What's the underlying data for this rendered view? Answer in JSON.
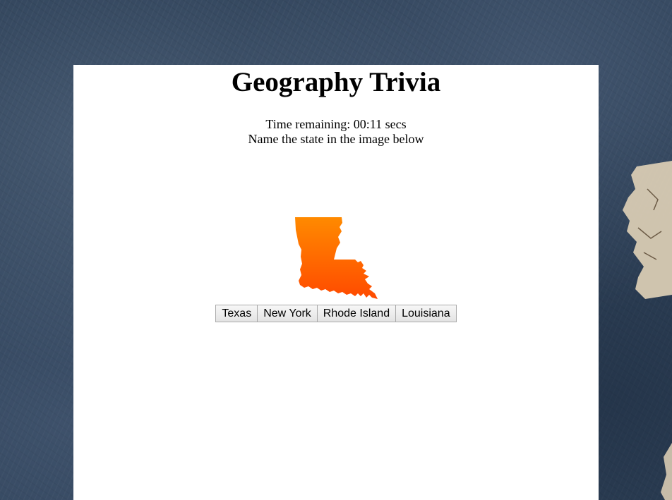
{
  "header": {
    "title": "Geography Trivia"
  },
  "quiz": {
    "timer_label": "Time remaining:",
    "time_remaining": "00:11",
    "time_unit": "secs",
    "prompt": "Name the state in the image below",
    "image_icon": "louisiana-state-outline-icon",
    "image_gradient": [
      "#ff8a00",
      "#ff4a00"
    ],
    "answers": [
      {
        "label": "Texas"
      },
      {
        "label": "New York"
      },
      {
        "label": "Rhode Island"
      },
      {
        "label": "Louisiana"
      }
    ]
  },
  "colors": {
    "background": "#2f4259",
    "panel": "#ffffff",
    "button_border": "#a9a9a9"
  }
}
